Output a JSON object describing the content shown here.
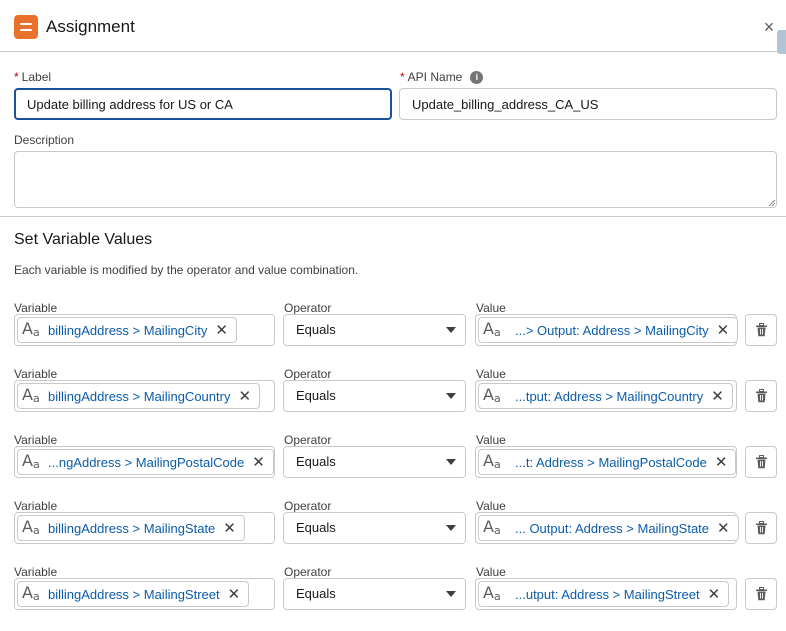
{
  "header": {
    "title": "Assignment",
    "close_symbol": "×"
  },
  "form": {
    "label_label": "Label",
    "label_value": "Update billing address for US or CA",
    "api_label": "API Name",
    "api_value": "Update_billing_address_CA_US",
    "required_marker": "*",
    "info_symbol": "i",
    "description_label": "Description",
    "description_value": ""
  },
  "section": {
    "title": "Set Variable Values",
    "help": "Each variable is modified by the operator and value combination."
  },
  "columns": {
    "variable": "Variable",
    "operator": "Operator",
    "value": "Value"
  },
  "rows": [
    {
      "variable": "billingAddress > MailingCity",
      "operator": "Equals",
      "value": "...> Output: Address > MailingCity"
    },
    {
      "variable": "billingAddress > MailingCountry",
      "operator": "Equals",
      "value": "...tput: Address > MailingCountry"
    },
    {
      "variable": "...ngAddress > MailingPostalCode",
      "operator": "Equals",
      "value": "...t: Address > MailingPostalCode"
    },
    {
      "variable": "billingAddress > MailingState",
      "operator": "Equals",
      "value": "... Output: Address > MailingState"
    },
    {
      "variable": "billingAddress > MailingStreet",
      "operator": "Equals",
      "value": "...utput: Address > MailingStreet"
    }
  ],
  "icons": {
    "header": "assignment-icon",
    "text_type": "text-type-icon",
    "remove": "close-icon",
    "delete": "trash-icon"
  },
  "colors": {
    "accent": "#e8712b",
    "link": "#0b5cab",
    "focus": "#1b5297",
    "required": "#ba0517"
  }
}
